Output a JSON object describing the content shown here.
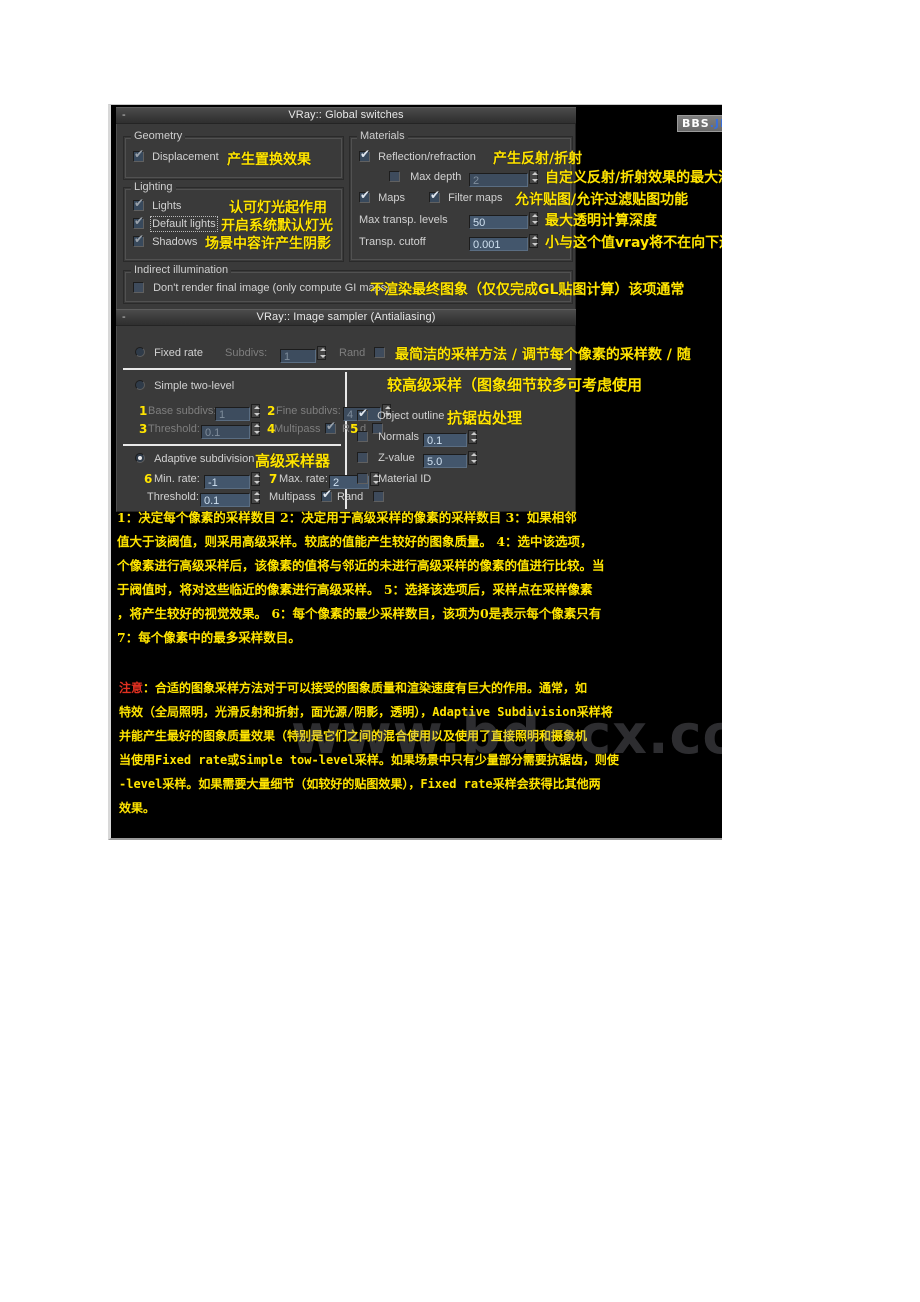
{
  "document": {
    "watermark": "www.bdocx.com",
    "bbs_badge": {
      "part1": "BBS",
      "part2": ".JI"
    }
  },
  "global_switches": {
    "title": "VRay:: Global switches",
    "collapse_glyph": "-",
    "geometry": {
      "group_label": "Geometry",
      "displacement": {
        "label": "Displacement",
        "checked": true,
        "annotation": "产生置换效果"
      }
    },
    "lighting": {
      "group_label": "Lighting",
      "lights": {
        "label": "Lights",
        "checked": true,
        "annotation": "认可灯光起作用"
      },
      "default_lights": {
        "label": "Default lights",
        "checked": true,
        "annotation": "开启系统默认灯光"
      },
      "shadows": {
        "label": "Shadows",
        "checked": true,
        "annotation": "场景中容许产生阴影"
      }
    },
    "materials": {
      "group_label": "Materials",
      "reflection_refraction": {
        "label": "Reflection/refraction",
        "checked": true,
        "annotation": "产生反射/折射"
      },
      "max_depth": {
        "label": "Max depth",
        "checked": false,
        "value": "2",
        "annotation": "自定义反射/折射效果的最大深"
      },
      "maps": {
        "label": "Maps",
        "checked": true
      },
      "filter_maps": {
        "label": "Filter maps",
        "checked": true,
        "annotation": "允许贴图/允许过滤贴图功能"
      },
      "max_transp_levels": {
        "label": "Max transp. levels",
        "value": "50",
        "annotation": "最大透明计算深度"
      },
      "transp_cutoff": {
        "label": "Transp. cutoff",
        "value": "0.001",
        "annotation": "小与这个值vray将不在向下进"
      }
    },
    "indirect_illumination": {
      "group_label": "Indirect illumination",
      "dont_render": {
        "label": "Don't render final image (only compute GI maps)",
        "checked": false,
        "annotation": "不渲染最终图象（仅仅完成GL贴图计算）该项通常"
      }
    }
  },
  "image_sampler": {
    "title": "VRay:: Image sampler (Antialiasing)",
    "collapse_glyph": "-",
    "fixed_rate": {
      "label": "Fixed rate",
      "selected": false,
      "subdivs_label": "Subdivs:",
      "subdivs_value": "1",
      "rand_label": "Rand",
      "rand_checked": false,
      "annotation": "最简洁的采样方法 / 调节每个像素的采样数 / 随"
    },
    "simple_two_level": {
      "label": "Simple two-level",
      "selected": false,
      "base_subdivs_label": "Base subdivs:",
      "base_subdivs_value": "1",
      "fine_subdivs_label": "Fine subdivs:",
      "fine_subdivs_value": "4",
      "threshold_label": "Threshold:",
      "threshold_value": "0.1",
      "multipass_label": "Multipass",
      "multipass_checked": true,
      "rand_label_left": "R",
      "rand_label_right": "d",
      "rand_checked": false,
      "markers": [
        "1",
        "2",
        "3",
        "4",
        "5"
      ]
    },
    "adaptive_subdivision": {
      "label": "Adaptive subdivision",
      "selected": true,
      "annotation": "高级采样器",
      "min_rate_label": "Min. rate:",
      "min_rate_value": "-1",
      "max_rate_label": "Max. rate:",
      "max_rate_value": "2",
      "threshold_label": "Threshold:",
      "threshold_value": "0.1",
      "multipass_label": "Multipass",
      "rand_label": "Rand",
      "rand_checked": true,
      "markers": [
        "6",
        "7"
      ]
    },
    "right_column": {
      "annotation": "较高级采样（图象细节较多可考虑使用",
      "object_outline": {
        "label": "Object outline",
        "checked": true,
        "annotation": "抗锯齿处理"
      },
      "normals": {
        "label": "Normals",
        "checked": false,
        "value": "0.1"
      },
      "z_value": {
        "label": "Z-value",
        "checked": false,
        "value": "5.0"
      },
      "material_id": {
        "label": "Material ID",
        "checked": false
      }
    }
  },
  "notes_block": {
    "lines": [
      "1：决定每个像素的采样数目     2：决定用于高级采样的像素的采样数目     3：如果相邻",
      "值大于该阀值，则采用高级采样。较底的值能产生较好的图象质量。    4：选中该选项，",
      "个像素进行高级采样后，该像素的值将与邻近的未进行高级采样的像素的值进行比较。当",
      "于阀值时，将对这些临近的像素进行高级采样。    5：选择该选项后，采样点在采样像素",
      "，将产生较好的视觉效果。    6：每个像素的最少采样数目，该项为0是表示每个像素只有",
      "7：每个像素中的最多采样数目。"
    ]
  },
  "caution_block": {
    "prefix": "注意",
    "lines": [
      "：合适的图象采样方法对于可以接受的图象质量和渲染速度有巨大的作用。通常，如",
      "特效（全局照明，光滑反射和折射，面光源/阴影，透明），Adaptive Subdivision采样将",
      "并能产生最好的图象质量效果（特别是它们之间的混合使用以及使用了直接照明和摄象机",
      "当使用Fixed rate或Simple tow-level采样。如果场景中只有少量部分需要抗锯齿，则使",
      "-level采样。如果需要大量细节（如较好的贴图效果），Fixed rate采样会获得比其他两",
      "效果。"
    ]
  },
  "colors": {
    "annotation_yellow": "#ffe400",
    "caution_red": "#e03020",
    "panel_gray": "#3a3a3a",
    "field_blue": "#43566c",
    "page_black": "#000000"
  }
}
